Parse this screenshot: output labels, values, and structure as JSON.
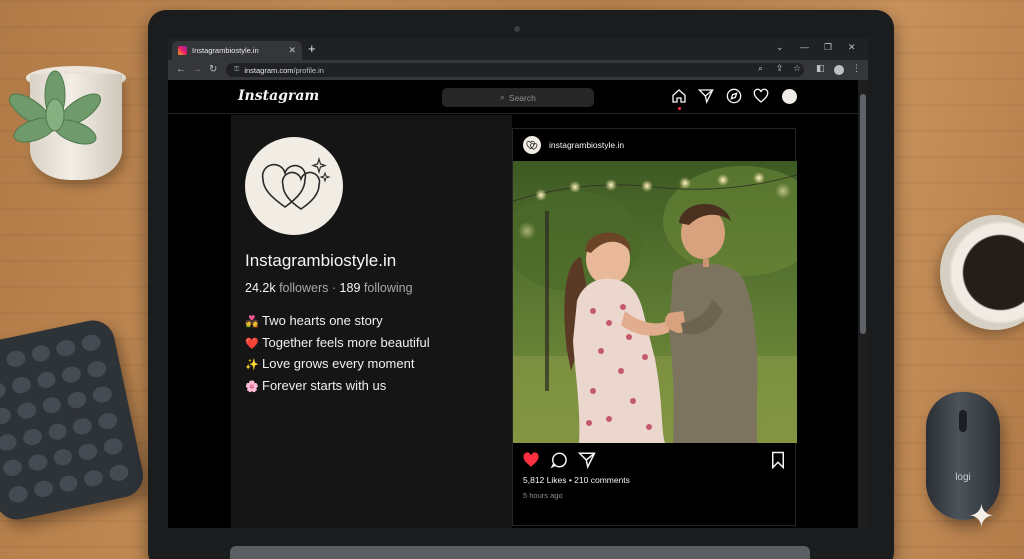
{
  "browser": {
    "tab_title": "Instagrambiostyle.in",
    "url_host": "instagram.com",
    "url_path": "/profile.in"
  },
  "instagram": {
    "logo": "Instagram",
    "search_placeholder": "Search"
  },
  "profile": {
    "username": "Instagrambiostyle.in",
    "followers_count": "24.2k",
    "followers_label": "followers",
    "separator": "·",
    "following_count": "189",
    "following_label": "following",
    "bio": [
      {
        "emoji": "💑",
        "text": "Two hearts one story"
      },
      {
        "emoji": "❤️",
        "text": "Together feels more beautiful"
      },
      {
        "emoji": "✨",
        "text": "Love grows every moment"
      },
      {
        "emoji": "🌸",
        "text": "Forever starts with us"
      }
    ]
  },
  "post": {
    "username": "instagrambiostyle.in",
    "likes_comments": "5,812 Likes • 210 comments",
    "time": "5 hours ago"
  },
  "desk": {
    "mouse_brand": "logi"
  },
  "colors": {
    "like_red": "#ff3040",
    "page_bg": "#000000",
    "panel_bg": "#151515"
  }
}
